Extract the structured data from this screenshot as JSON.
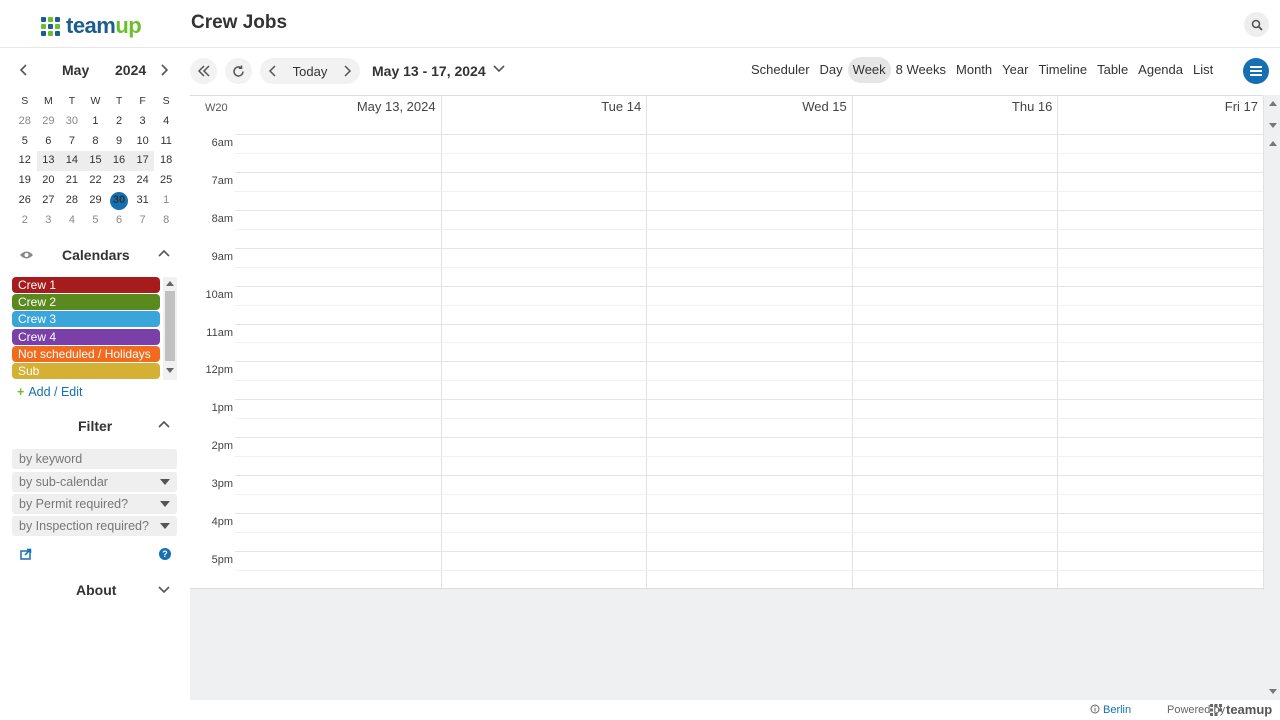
{
  "header": {
    "logo_team": "team",
    "logo_up": "up",
    "title": "Crew Jobs"
  },
  "mini_calendar": {
    "month": "May",
    "year": "2024",
    "dow": [
      "S",
      "M",
      "T",
      "W",
      "T",
      "F",
      "S"
    ],
    "weeks": [
      [
        "28",
        "29",
        "30",
        "1",
        "2",
        "3",
        "4"
      ],
      [
        "5",
        "6",
        "7",
        "8",
        "9",
        "10",
        "11"
      ],
      [
        "12",
        "13",
        "14",
        "15",
        "16",
        "17",
        "18"
      ],
      [
        "19",
        "20",
        "21",
        "22",
        "23",
        "24",
        "25"
      ],
      [
        "26",
        "27",
        "28",
        "29",
        "30",
        "31",
        "1"
      ],
      [
        "2",
        "3",
        "4",
        "5",
        "6",
        "7",
        "8"
      ]
    ],
    "today": "30"
  },
  "calendars": {
    "title": "Calendars",
    "items": [
      {
        "label": "Crew 1",
        "color": "#a61c1c"
      },
      {
        "label": "Crew 2",
        "color": "#5a8a1e"
      },
      {
        "label": "Crew 3",
        "color": "#3aa5d8"
      },
      {
        "label": "Crew 4",
        "color": "#7a3fa8"
      },
      {
        "label": "Not scheduled / Holidays",
        "color": "#f06b1e"
      },
      {
        "label": "Sub",
        "color": "#d4b035"
      }
    ],
    "add_edit": "Add / Edit"
  },
  "filter": {
    "title": "Filter",
    "keyword_placeholder": "by keyword",
    "sub_calendar": "by sub-calendar",
    "permit": "by Permit required?",
    "inspection": "by Inspection required?"
  },
  "about": {
    "title": "About"
  },
  "toolbar": {
    "today": "Today",
    "range": "May 13 - 17, 2024",
    "views": [
      "Scheduler",
      "Day",
      "Week",
      "8 Weeks",
      "Month",
      "Year",
      "Timeline",
      "Table",
      "Agenda",
      "List"
    ],
    "active_view": "Week"
  },
  "grid": {
    "week_number": "W20",
    "days": [
      "May 13, 2024",
      "Tue 14",
      "Wed 15",
      "Thu 16",
      "Fri 17"
    ],
    "hours": [
      "6am",
      "7am",
      "8am",
      "9am",
      "10am",
      "11am",
      "12pm",
      "1pm",
      "2pm",
      "3pm",
      "4pm",
      "5pm"
    ]
  },
  "footer": {
    "timezone": "Berlin",
    "powered_by": "Powered by",
    "brand": "teamup"
  },
  "colors": {
    "accent": "#1470b3",
    "brand_green": "#6bbf2a"
  }
}
